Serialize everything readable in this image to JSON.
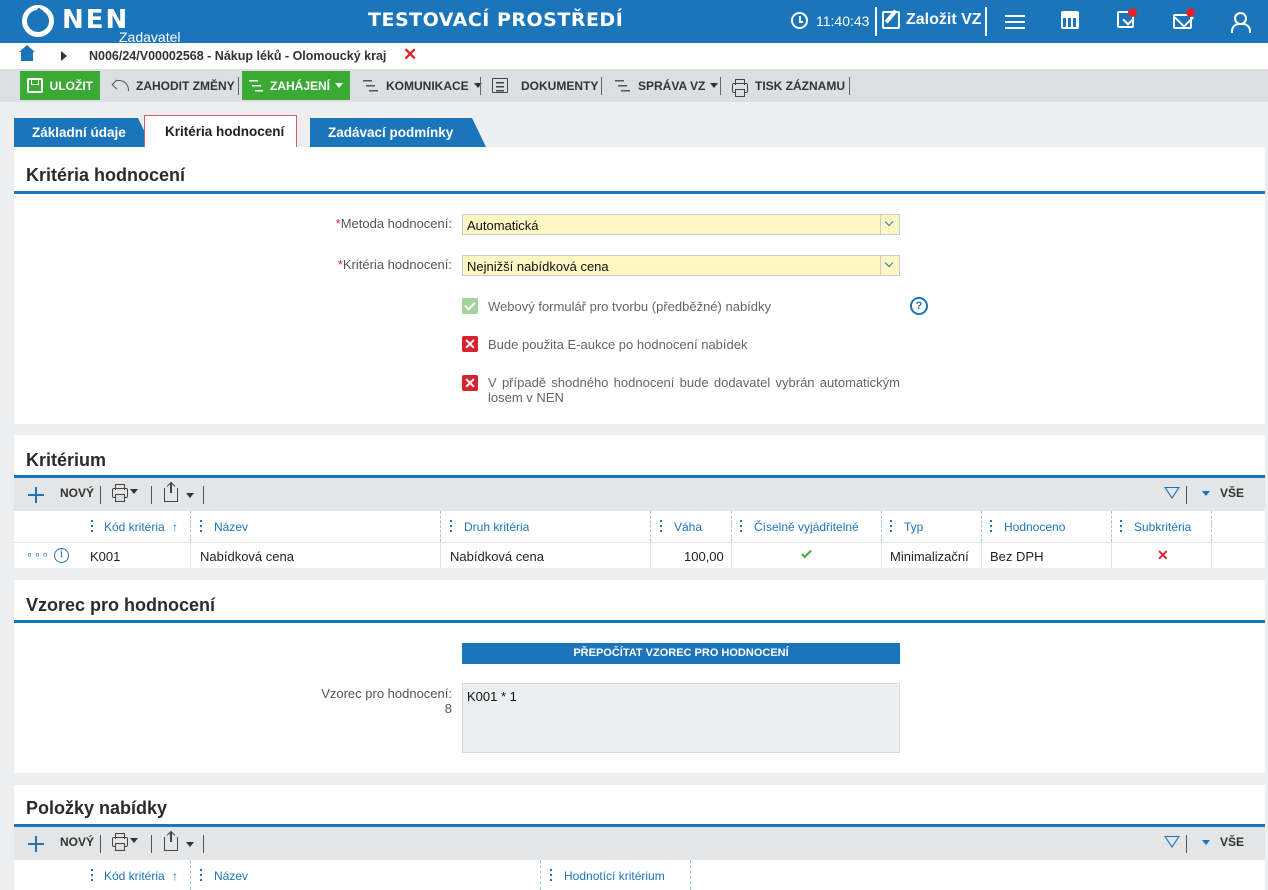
{
  "header": {
    "logo_text": "NEN",
    "logo_sub": "Zadavatel",
    "env_title": "TESTOVACÍ PROSTŘEDÍ",
    "time": "11:40:43",
    "create_vz": "Založit VZ",
    "icons": [
      "clock-icon",
      "edit-icon",
      "menu-icon",
      "calculator-icon",
      "inbox-icon",
      "mail-icon",
      "user-icon"
    ],
    "notification_color": "#e3212d",
    "brand_color": "#1b75bb"
  },
  "breadcrumb": {
    "text": "N006/24/V00002568 - Nákup léků - Olomoucký kraj",
    "close": "✕"
  },
  "toolbar": {
    "save": "ULOŽIT",
    "discard": "ZAHODIT ZMĚNY",
    "start": "ZAHÁJENÍ",
    "communication": "KOMUNIKACE",
    "documents": "DOKUMENTY",
    "manage": "SPRÁVA VZ",
    "print": "TISK ZÁZNAMU"
  },
  "tabs": [
    {
      "label": "Základní údaje"
    },
    {
      "label": "Kritéria hodnocení",
      "active": true
    },
    {
      "label": "Zadávací podmínky"
    }
  ],
  "criteria_panel": {
    "title": "Kritéria hodnocení",
    "method_label": "Metoda hodnocení:",
    "method_value": "Automatická",
    "criteria_label": "Kritéria hodnocení:",
    "criteria_value": "Nejnižší nabídková cena",
    "checkboxes": [
      {
        "label": "Webový formulář pro tvorbu (předběžné) nabídky",
        "checked": true
      },
      {
        "label": "Bude použita E-aukce po hodnocení nabídek",
        "checked": false
      },
      {
        "label": "V případě shodného hodnocení bude dodavatel vybrán automatickým losem v NEN",
        "checked": false
      }
    ],
    "help": "?"
  },
  "kriterium_panel": {
    "title": "Kritérium",
    "new": "NOVÝ",
    "all": "VŠE",
    "columns": [
      "Kód kritéria",
      "Název",
      "Druh kritéria",
      "Váha",
      "Číselně vyjádřitelné",
      "Typ",
      "Hodnoceno",
      "Subkritéria"
    ],
    "sort_indicator": "↑",
    "rows": [
      {
        "code": "K001",
        "name": "Nabídková cena",
        "kind": "Nabídková cena",
        "weight": "100,00",
        "numeric": true,
        "type": "Minimalizační",
        "evaluated": "Bez DPH",
        "sub": false
      }
    ],
    "row_menu": "∘∘∘",
    "row_info": "i"
  },
  "formula_panel": {
    "title": "Vzorec pro hodnocení",
    "button": "PŘEPOČÍTAT VZOREC PRO HODNOCENÍ",
    "label": "Vzorec pro hodnocení:",
    "label_count": "8",
    "value": "K001 * 1"
  },
  "items_panel": {
    "title": "Položky nabídky",
    "new": "NOVÝ",
    "all": "VŠE",
    "columns": [
      "Kód kritéria",
      "Název",
      "Hodnotící kritérium"
    ],
    "sort_indicator": "↑"
  }
}
